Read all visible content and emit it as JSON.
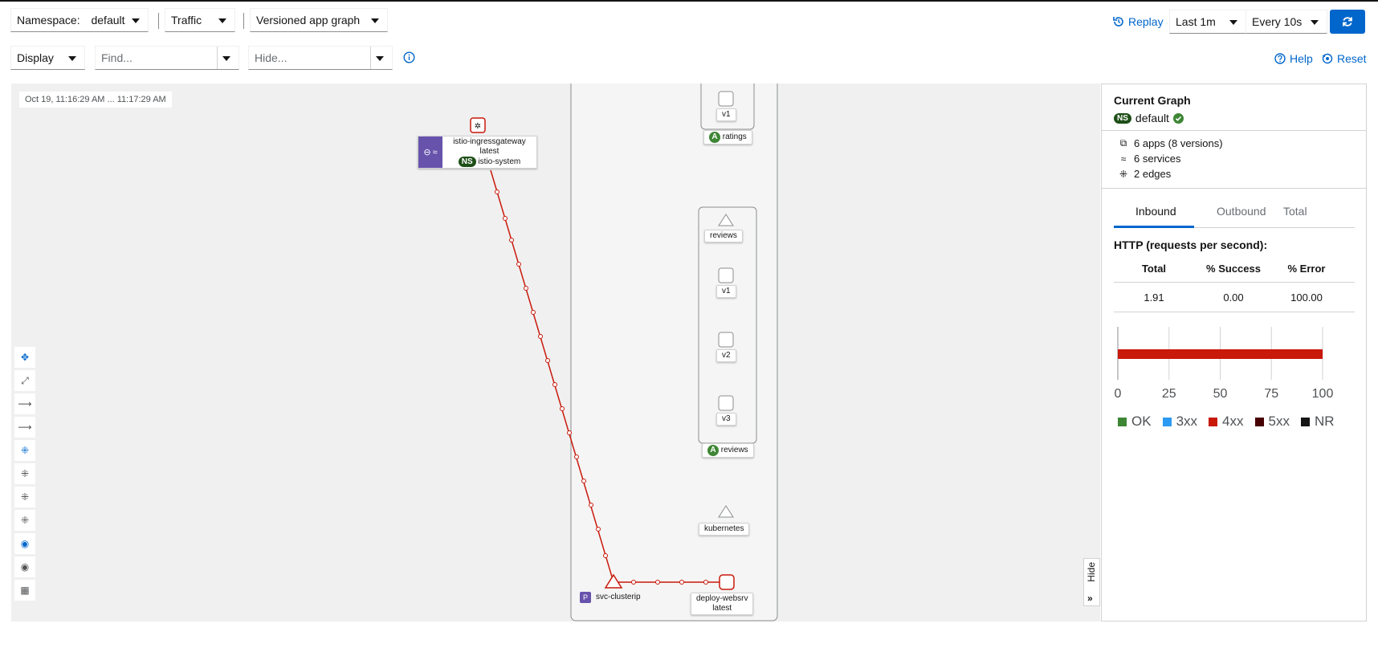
{
  "toolbar": {
    "namespace_label": "Namespace:",
    "namespace_value": "default",
    "traffic": "Traffic",
    "graph_type": "Versioned app graph",
    "display": "Display",
    "find_placeholder": "Find...",
    "hide_placeholder": "Hide...",
    "replay": "Replay",
    "duration": "Last 1m",
    "refresh_interval": "Every 10s",
    "help": "Help",
    "reset": "Reset"
  },
  "graph": {
    "timestamp": "Oct 19, 11:16:29 AM ... 11:17:29 AM",
    "nodes": {
      "gateway_name": "istio-ingressgateway",
      "gateway_version": "latest",
      "gateway_ns_badge": "NS",
      "gateway_ns": "istio-system",
      "ratings_v1": "v1",
      "ratings_app_badge": "A",
      "ratings_app": "ratings",
      "reviews_service": "reviews",
      "reviews_v1": "v1",
      "reviews_v2": "v2",
      "reviews_v3": "v3",
      "reviews_app_badge": "A",
      "reviews_app": "reviews",
      "kubernetes": "kubernetes",
      "svc_clusterip": "svc-clusterip",
      "deploy_websrv": "deploy-websrv",
      "deploy_websrv_version": "latest"
    },
    "hide_tab": "Hide"
  },
  "panel": {
    "title": "Current Graph",
    "ns_badge": "NS",
    "namespace": "default",
    "apps": "6 apps (8 versions)",
    "services": "6 services",
    "edges": "2 edges",
    "tabs": [
      "Inbound",
      "Outbound",
      "Total"
    ],
    "http_title": "HTTP (requests per second):",
    "columns": [
      "Total",
      "% Success",
      "% Error"
    ],
    "values": [
      "1.91",
      "0.00",
      "100.00"
    ],
    "chart_ticks": [
      "0",
      "25",
      "50",
      "75",
      "100"
    ],
    "legend": [
      {
        "label": "OK",
        "color": "#3e8635"
      },
      {
        "label": "3xx",
        "color": "#2b9af3"
      },
      {
        "label": "4xx",
        "color": "#c9190b"
      },
      {
        "label": "5xx",
        "color": "#470000"
      },
      {
        "label": "NR",
        "color": "#151515"
      }
    ]
  },
  "chart_data": {
    "type": "bar",
    "categories": [
      ""
    ],
    "series": [
      {
        "name": "4xx",
        "values": [
          100
        ]
      }
    ],
    "xlim": [
      0,
      100
    ],
    "legend": "bottom"
  },
  "colors": {
    "accent": "#0066cc",
    "error_edge": "#c9190b",
    "graph_bg": "#f0f0f0"
  }
}
